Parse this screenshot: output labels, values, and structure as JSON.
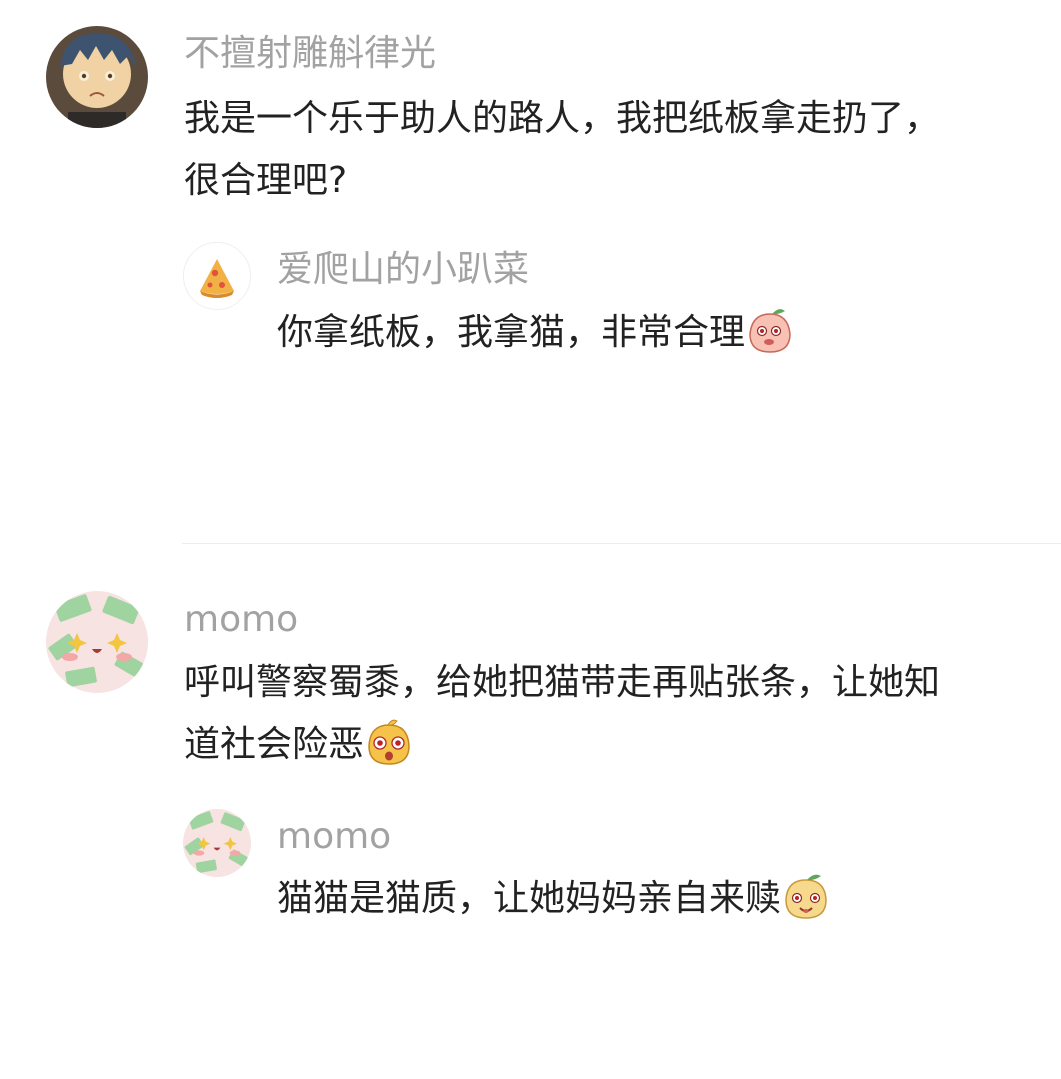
{
  "comments": [
    {
      "username": "不擅射雕斛律光",
      "line1": "我是一个乐于助人的路人，我把纸板拿走扔了，",
      "line2": "很合理吧?",
      "reply": {
        "username": "爱爬山的小趴菜",
        "text": "你拿纸板，我拿猫，非常合理",
        "emoji": "shy-peach-emoji"
      }
    },
    {
      "username": "momo",
      "line1": "呼叫警察蜀黍，给她把猫带走再贴张条，让她知",
      "line2": "道社会险恶",
      "emoji": "shocked-face-emoji",
      "reply": {
        "username": "momo",
        "text": "猫猫是猫质，让她妈妈亲自来赎",
        "emoji": "smug-face-emoji"
      }
    }
  ],
  "colors": {
    "username": "#a2a2a2",
    "text": "#222222",
    "divider": "#ececec"
  }
}
